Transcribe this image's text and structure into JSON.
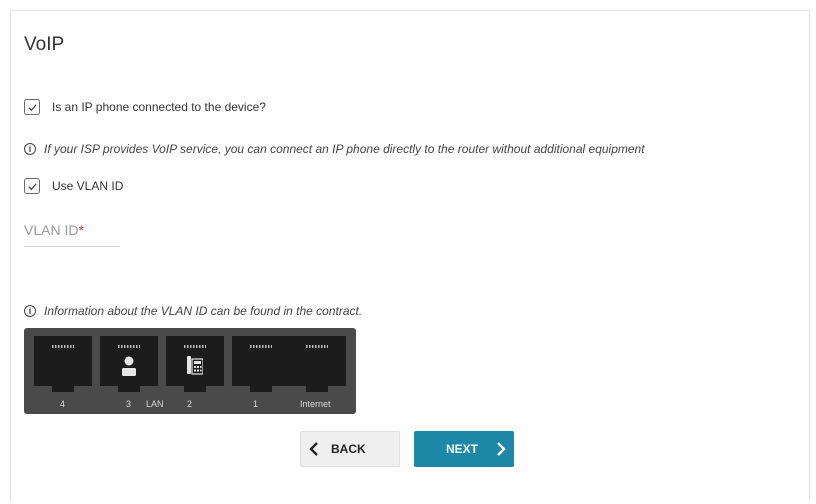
{
  "page": {
    "title": "VoIP",
    "ip_phone_checkbox": {
      "label": "Is an IP phone connected to the device?",
      "checked": true
    },
    "info_isp": "If your ISP provides VoIP service, you can connect an IP phone directly to the router without additional equipment",
    "vlan_checkbox": {
      "label": "Use VLAN ID",
      "checked": true
    },
    "vlan_field": {
      "label": "VLAN ID",
      "required_mark": "*",
      "value": ""
    },
    "info_vlan": "Information about the VLAN ID can be found in the contract.",
    "info_icon_glyph": "i"
  },
  "ports": {
    "labels": {
      "p4": "4",
      "p3": "3",
      "lan": "LAN",
      "p2": "2",
      "p1": "1",
      "internet": "Internet"
    },
    "port3_icon": "person-icon",
    "port2_icon": "phone-icon"
  },
  "buttons": {
    "back": "BACK",
    "next": "NEXT"
  },
  "colors": {
    "next_button": "#1d87a8",
    "required": "#d13b3b",
    "port_panel": "#4a4a4a"
  }
}
